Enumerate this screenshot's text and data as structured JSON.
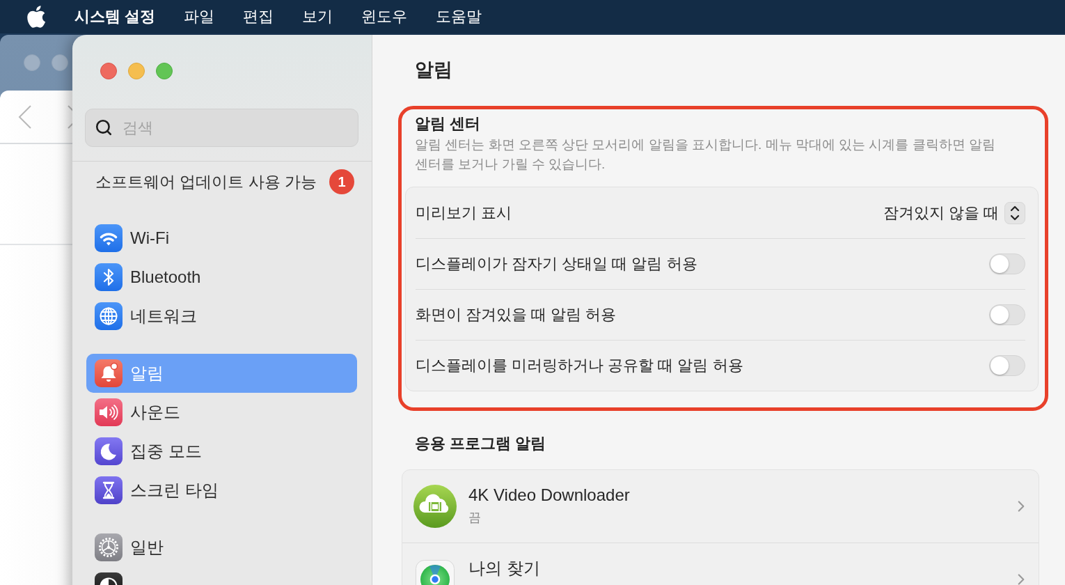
{
  "menu_bar": {
    "app_name": "시스템 설정",
    "menus": [
      "파일",
      "편집",
      "보기",
      "윈도우",
      "도움말"
    ]
  },
  "sidebar": {
    "search": {
      "placeholder": "검색"
    },
    "update_notice": {
      "label": "소프트웨어 업데이트 사용 가능",
      "badge": "1"
    },
    "groups": [
      {
        "items": [
          {
            "kind": "wifi",
            "label": "Wi-Fi",
            "selected": false
          },
          {
            "kind": "bluetooth",
            "label": "Bluetooth",
            "selected": false
          },
          {
            "kind": "network",
            "label": "네트워크",
            "selected": false
          }
        ]
      },
      {
        "items": [
          {
            "kind": "notifications",
            "label": "알림",
            "selected": true
          },
          {
            "kind": "sound",
            "label": "사운드",
            "selected": false
          },
          {
            "kind": "focus",
            "label": "집중 모드",
            "selected": false
          },
          {
            "kind": "screen_time",
            "label": "스크린 타임",
            "selected": false
          }
        ]
      },
      {
        "items": [
          {
            "kind": "general",
            "label": "일반",
            "selected": false
          },
          {
            "kind": "display_mode",
            "selected": false
          }
        ]
      }
    ]
  },
  "content": {
    "title": "알림",
    "notification_center": {
      "title": "알림 센터",
      "description": "알림 센터는 화면 오른쪽 상단 모서리에 알림을 표시합니다. 메뉴 막대에 있는 시계를 클릭하면 알림 센터를 보거나 가릴 수 있습니다.",
      "settings": [
        {
          "kind": "popup",
          "label": "미리보기 표시",
          "value": "잠겨있지 않을 때"
        },
        {
          "kind": "toggle",
          "label": "디스플레이가 잠자기 상태일 때 알림 허용",
          "on": false
        },
        {
          "kind": "toggle",
          "label": "화면이 잠겨있을 때 알림 허용",
          "on": false
        },
        {
          "kind": "toggle",
          "label": "디스플레이를 미러링하거나 공유할 때 알림 허용",
          "on": false
        }
      ]
    },
    "app_notifications": {
      "title": "응용 프로그램 알림",
      "apps": [
        {
          "kind": "video_downloader",
          "name": "4K Video Downloader",
          "status": "끔"
        },
        {
          "kind": "find_my",
          "name": "나의 찾기"
        }
      ]
    }
  }
}
